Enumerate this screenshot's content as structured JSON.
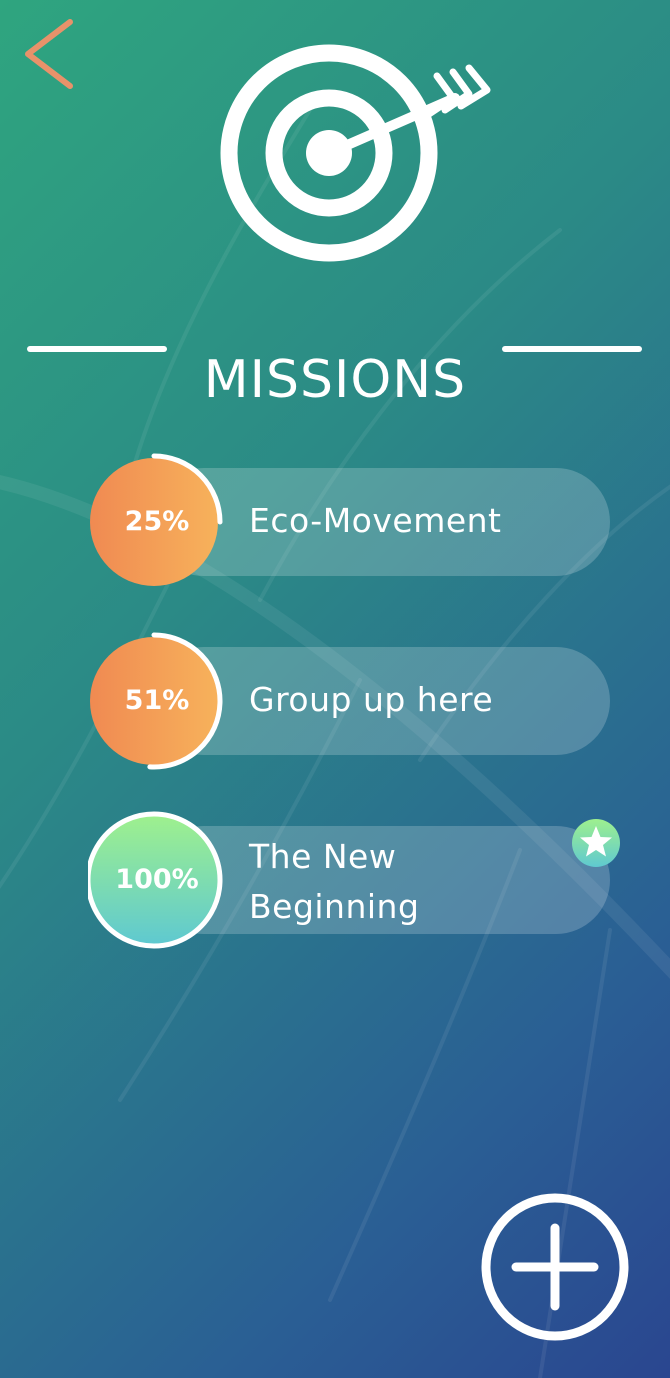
{
  "header": {
    "back_icon": "chevron-left-icon",
    "logo_icon": "target-arrow-icon",
    "title": "MISSIONS",
    "accent_color": "#e8926a"
  },
  "missions": [
    {
      "percent_label": "25%",
      "progress": 0.25,
      "name": "Eco-Movement",
      "colors": [
        "#f08a52",
        "#f7b25b"
      ],
      "completed": false
    },
    {
      "percent_label": "51%",
      "progress": 0.51,
      "name": "Group up here",
      "colors": [
        "#f08a52",
        "#f7b25b"
      ],
      "completed": false
    },
    {
      "percent_label": "100%",
      "progress": 1.0,
      "name": "The New\nBeginning",
      "colors": [
        "#9ef08e",
        "#5fc9d0"
      ],
      "completed": true,
      "badge_icon": "star-icon"
    }
  ],
  "fab": {
    "icon": "plus-icon"
  }
}
